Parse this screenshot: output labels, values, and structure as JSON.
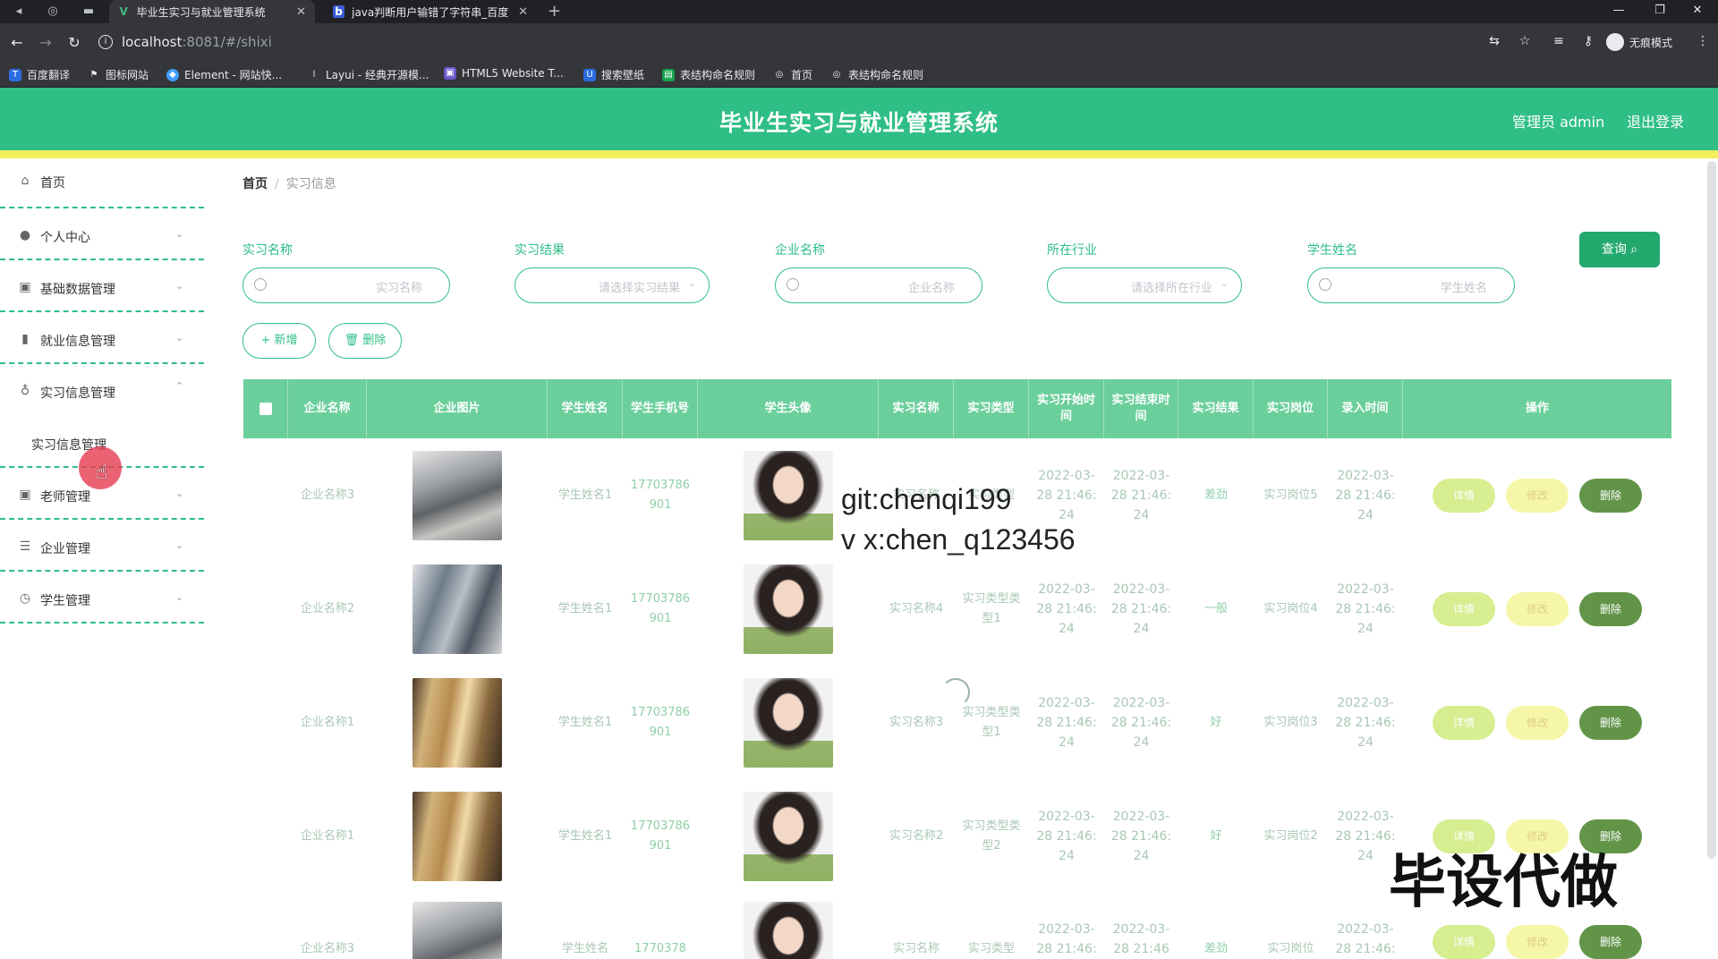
{
  "browser": {
    "tabs": [
      {
        "title": "毕业生实习与就业管理系统",
        "active": true
      },
      {
        "title": "java判断用户输错了字符串_百度",
        "active": false
      }
    ],
    "new_tab": "+",
    "url_host": "localhost",
    "url_path": ":8081/#/shixi",
    "incognito_label": "无痕模式",
    "bookmarks": [
      "百度翻译",
      "图标网站",
      "Element - 网站快...",
      "Layui - 经典开源模...",
      "HTML5 Website T...",
      "搜索壁纸",
      "表结构命名规则",
      "首页",
      "表结构命名规则"
    ]
  },
  "header": {
    "title": "毕业生实习与就业管理系统",
    "user": "管理员 admin",
    "logout": "退出登录"
  },
  "sidebar": {
    "items": [
      {
        "label": "首页",
        "icon": "home-icon"
      },
      {
        "label": "个人中心",
        "icon": "user-icon"
      },
      {
        "label": "基础数据管理",
        "icon": "clipboard-icon"
      },
      {
        "label": "就业信息管理",
        "icon": "bar-chart-icon"
      },
      {
        "label": "实习信息管理",
        "icon": "mic-icon"
      },
      {
        "label": "老师管理",
        "icon": "clipboard-icon"
      },
      {
        "label": "企业管理",
        "icon": "list-icon"
      },
      {
        "label": "学生管理",
        "icon": "compass-icon"
      }
    ],
    "sub_item": "实习信息管理"
  },
  "breadcrumb": {
    "home": "首页",
    "separator": "/",
    "current": "实习信息"
  },
  "filters": [
    {
      "label": "实习名称",
      "placeholder": "实习名称",
      "type": "input"
    },
    {
      "label": "实习结果",
      "placeholder": "请选择实习结果",
      "type": "select"
    },
    {
      "label": "企业名称",
      "placeholder": "企业名称",
      "type": "input"
    },
    {
      "label": "所在行业",
      "placeholder": "请选择所在行业",
      "type": "select"
    },
    {
      "label": "学生姓名",
      "placeholder": "学生姓名",
      "type": "input"
    }
  ],
  "buttons": {
    "query": "查询",
    "add": "+ 新增",
    "delete": "删除"
  },
  "table": {
    "columns": [
      "企业名称",
      "企业图片",
      "学生姓名",
      "学生手机号",
      "学生头像",
      "实习名称",
      "实习类型",
      "实习开始时间",
      "实习结束时间",
      "实习结果",
      "实习岗位",
      "录入时间",
      "操作"
    ],
    "rows": [
      {
        "company": "企业名称3",
        "image": "office",
        "student": "学生姓名1",
        "phone": "17703786901",
        "name": "实习名称",
        "type": "实习类型",
        "start": "2022-03-28 21:46:24",
        "end": "2022-03-28 21:46:24",
        "result": "差劲",
        "post": "实习岗位5",
        "created": "2022-03-28 21:46:24"
      },
      {
        "company": "企业名称2",
        "image": "office2",
        "student": "学生姓名1",
        "phone": "17703786901",
        "name": "实习名称4",
        "type": "实习类型类型1",
        "start": "2022-03-28 21:46:24",
        "end": "2022-03-28 21:46:24",
        "result": "一般",
        "post": "实习岗位4",
        "created": "2022-03-28 21:46:24"
      },
      {
        "company": "企业名称1",
        "image": "hall",
        "student": "学生姓名1",
        "phone": "17703786901",
        "name": "实习名称3",
        "type": "实习类型类型1",
        "start": "2022-03-28 21:46:24",
        "end": "2022-03-28 21:46:24",
        "result": "好",
        "post": "实习岗位3",
        "created": "2022-03-28 21:46:24"
      },
      {
        "company": "企业名称1",
        "image": "hall",
        "student": "学生姓名1",
        "phone": "17703786901",
        "name": "实习名称2",
        "type": "实习类型类型2",
        "start": "2022-03-28 21:46:24",
        "end": "2022-03-28 21:46:24",
        "result": "好",
        "post": "实习岗位2",
        "created": "2022-03-28 21:46:24"
      },
      {
        "company": "企业名称3",
        "image": "office",
        "student": "学生姓名",
        "phone": "1770378",
        "name": "实习名称",
        "type": "实习类型",
        "start": "2022-03-28 21:46:",
        "end": "2022-03-28 21:46",
        "result": "差劲",
        "post": "实习岗位",
        "created": "2022-03-28 21:46:"
      }
    ],
    "ops": {
      "detail": "详情",
      "edit": "修改",
      "delete": "删除"
    }
  },
  "overlays": {
    "line1": "git:chenqi199",
    "line2": "v x:chen_q123456",
    "big": "毕设代做"
  }
}
